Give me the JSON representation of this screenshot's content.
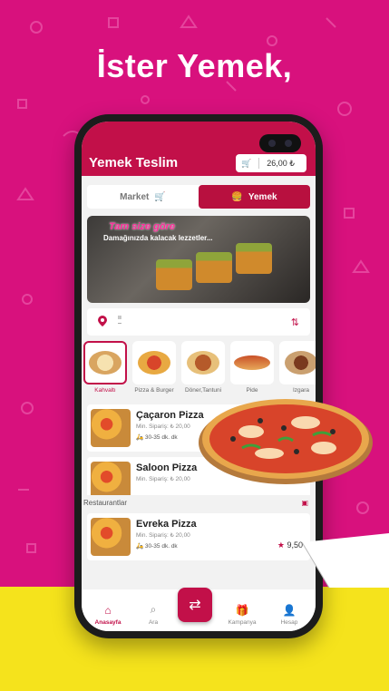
{
  "headline": "İster Yemek,",
  "app": {
    "brand": "Yemek Teslim",
    "cart_total": "26,00 ₺",
    "tabs": [
      {
        "label": "Market",
        "active": false
      },
      {
        "label": "Yemek",
        "active": true
      }
    ],
    "banner": {
      "title": "Tam size göre",
      "subtitle": "Damağınızda kalacak lezzetler..."
    },
    "location": {
      "line1": "ıı",
      "line2": "–"
    },
    "categories": [
      {
        "label": "Kahvaltı",
        "active": true
      },
      {
        "label": "Pizza & Burger",
        "active": false
      },
      {
        "label": "Döner,Tantuni",
        "active": false
      },
      {
        "label": "Pide",
        "active": false
      },
      {
        "label": "Izgara",
        "active": false
      }
    ],
    "restaurants_top": [
      {
        "name": "Çaçaron Pizza",
        "min_order_label": "Min. Sipariş:",
        "min_order": "20,00",
        "time": "30-35 dk. dk"
      },
      {
        "name": "Saloon Pizza",
        "min_order_label": "Min. Sipariş:",
        "min_order": "20,00"
      }
    ],
    "section_title": "Restaurantlar",
    "restaurants_bottom": [
      {
        "name": "Evreka Pizza",
        "min_order_label": "Min. Sipariş:",
        "min_order": "20,00",
        "time": "30-35 dk. dk",
        "rating": "9,50"
      }
    ],
    "nav": [
      {
        "label": "Anasayfa",
        "icon": "home-icon",
        "active": true
      },
      {
        "label": "Ara",
        "icon": "search-icon",
        "active": false
      },
      {
        "label": "Kampanya",
        "icon": "gift-icon",
        "active": false
      },
      {
        "label": "Hesap",
        "icon": "user-icon",
        "active": false
      }
    ]
  },
  "colors": {
    "background": "#d8117d",
    "accent": "#c21049",
    "yellow": "#f5e31c"
  }
}
